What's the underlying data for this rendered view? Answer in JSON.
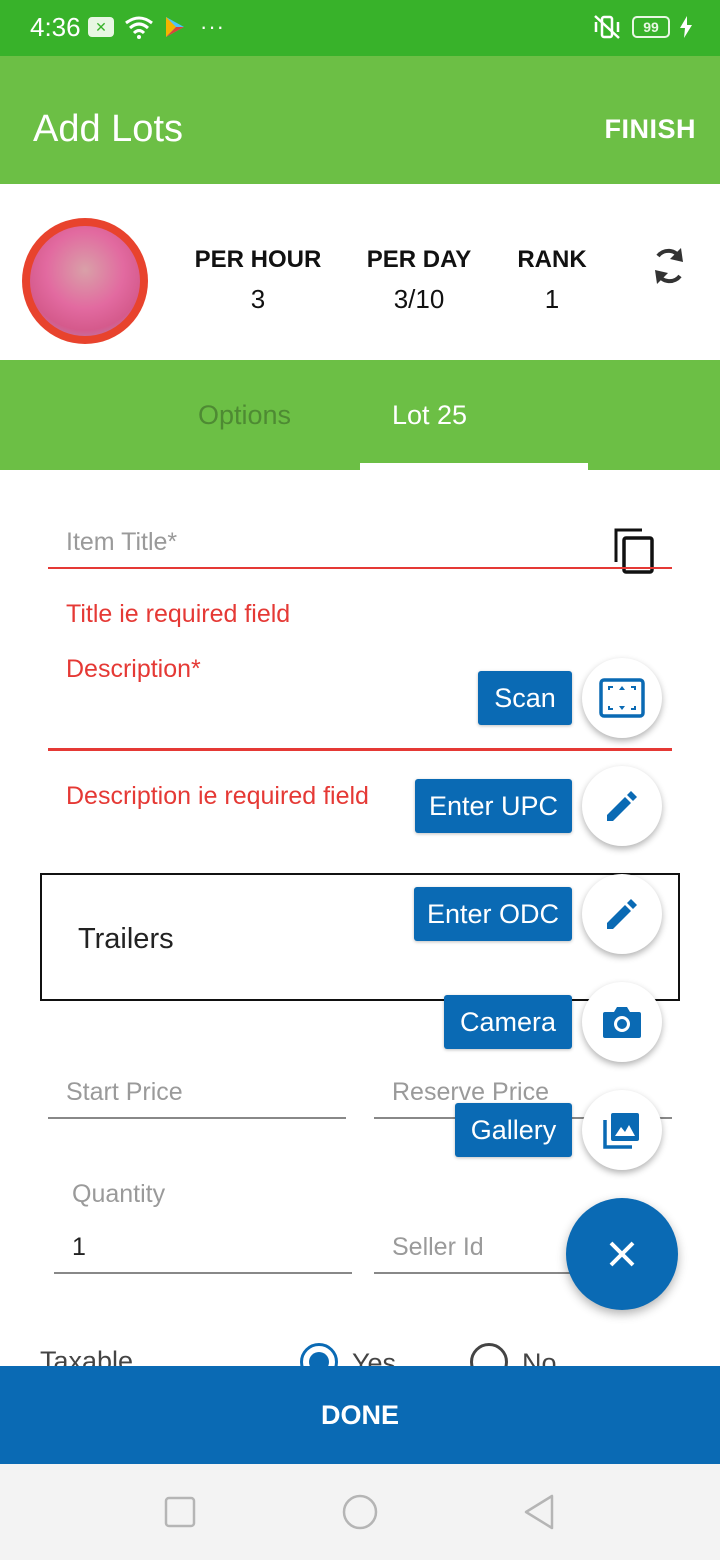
{
  "status_bar": {
    "time": "4:36",
    "battery": "99",
    "overflow": "···"
  },
  "app_bar": {
    "title": "Add Lots",
    "finish": "FINISH"
  },
  "stats": {
    "per_hour": {
      "label": "PER HOUR",
      "value": "3"
    },
    "per_day": {
      "label": "PER DAY",
      "value": "3/10"
    },
    "rank": {
      "label": "RANK",
      "value": "1"
    }
  },
  "tabs": [
    {
      "label": "Options",
      "selected": false
    },
    {
      "label": "Lot  25",
      "selected": true
    }
  ],
  "form": {
    "item_title": {
      "placeholder": "Item Title*",
      "error": "Title ie required field"
    },
    "description": {
      "label": "Description*",
      "error": "Description ie required field"
    },
    "category": {
      "value": "Trailers"
    },
    "start_price": {
      "placeholder": "Start Price"
    },
    "reserve_price": {
      "placeholder": "Reserve Price"
    },
    "quantity": {
      "label": "Quantity",
      "value": "1"
    },
    "seller_id": {
      "placeholder": "Seller Id"
    },
    "taxable": {
      "label": "Taxable",
      "options": [
        "Yes",
        "No"
      ],
      "selected": "Yes"
    }
  },
  "fab_menu": {
    "items": [
      {
        "label": "Scan",
        "icon": "scan-icon"
      },
      {
        "label": "Enter UPC",
        "icon": "pencil-icon"
      },
      {
        "label": "Enter ODC",
        "icon": "pencil-icon"
      },
      {
        "label": "Camera",
        "icon": "camera-icon"
      },
      {
        "label": "Gallery",
        "icon": "image-icon"
      }
    ],
    "close_icon": "close-icon"
  },
  "done_button": "DONE",
  "colors": {
    "status_bar": "#38b22a",
    "app_bar": "#6cbf45",
    "accent_blue": "#0a6ab4",
    "error_red": "#e53935"
  }
}
